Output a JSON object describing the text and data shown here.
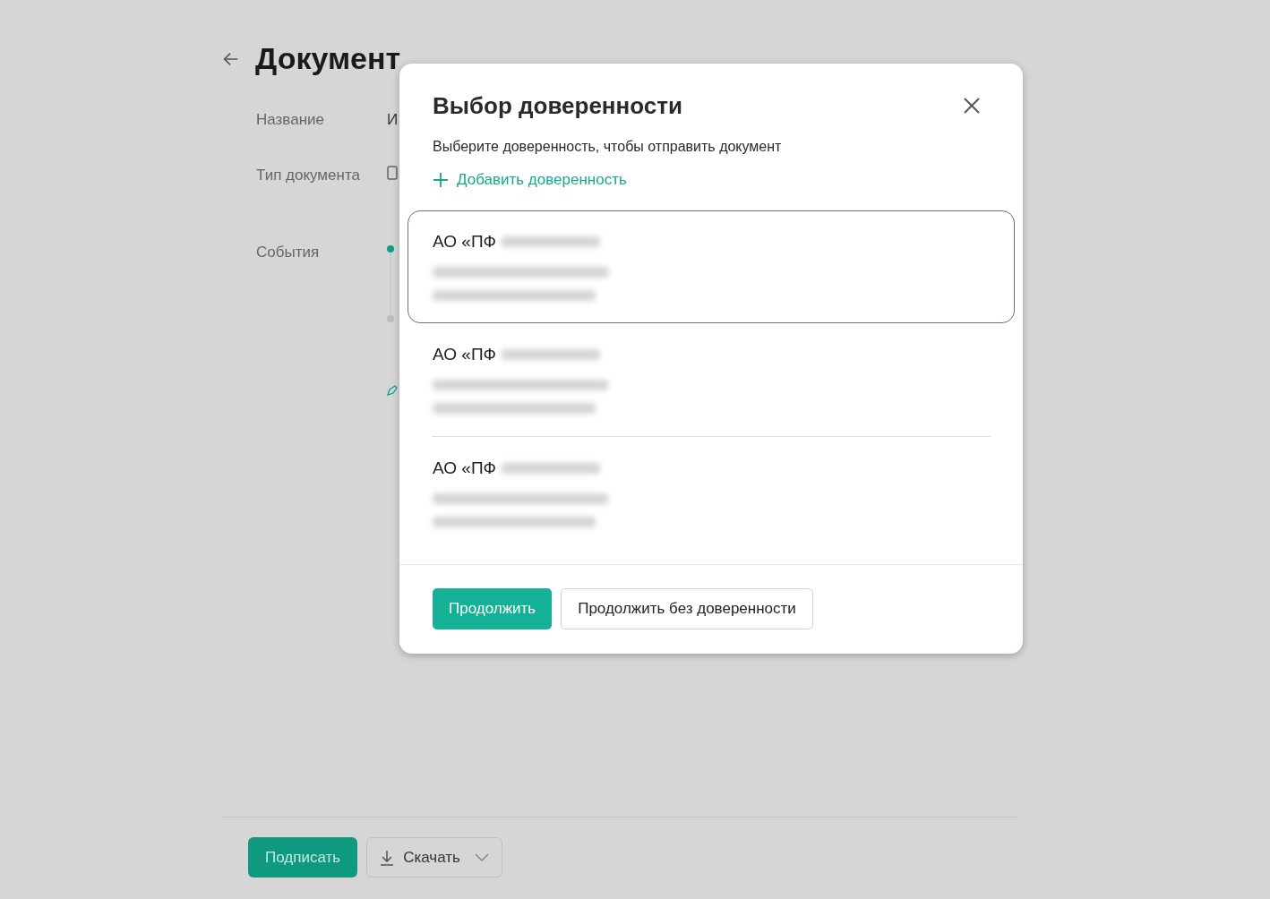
{
  "page": {
    "title": "Документ",
    "fields": [
      {
        "label": "Название",
        "value": "И"
      },
      {
        "label": "Тип документа"
      },
      {
        "label": "События"
      }
    ],
    "actions": {
      "sign": "Подписать",
      "download": "Скачать"
    }
  },
  "dialog": {
    "title": "Выбор доверенности",
    "subtitle": "Выберите доверенность, чтобы отправить документ",
    "add": "Добавить доверенность",
    "items": [
      {
        "name": "АО «ПФ",
        "selected": true
      },
      {
        "name": "АО «ПФ",
        "selected": false
      },
      {
        "name": "АО «ПФ",
        "selected": false
      }
    ],
    "buttons": {
      "primary": "Продолжить",
      "secondary": "Продолжить без доверенности"
    }
  }
}
